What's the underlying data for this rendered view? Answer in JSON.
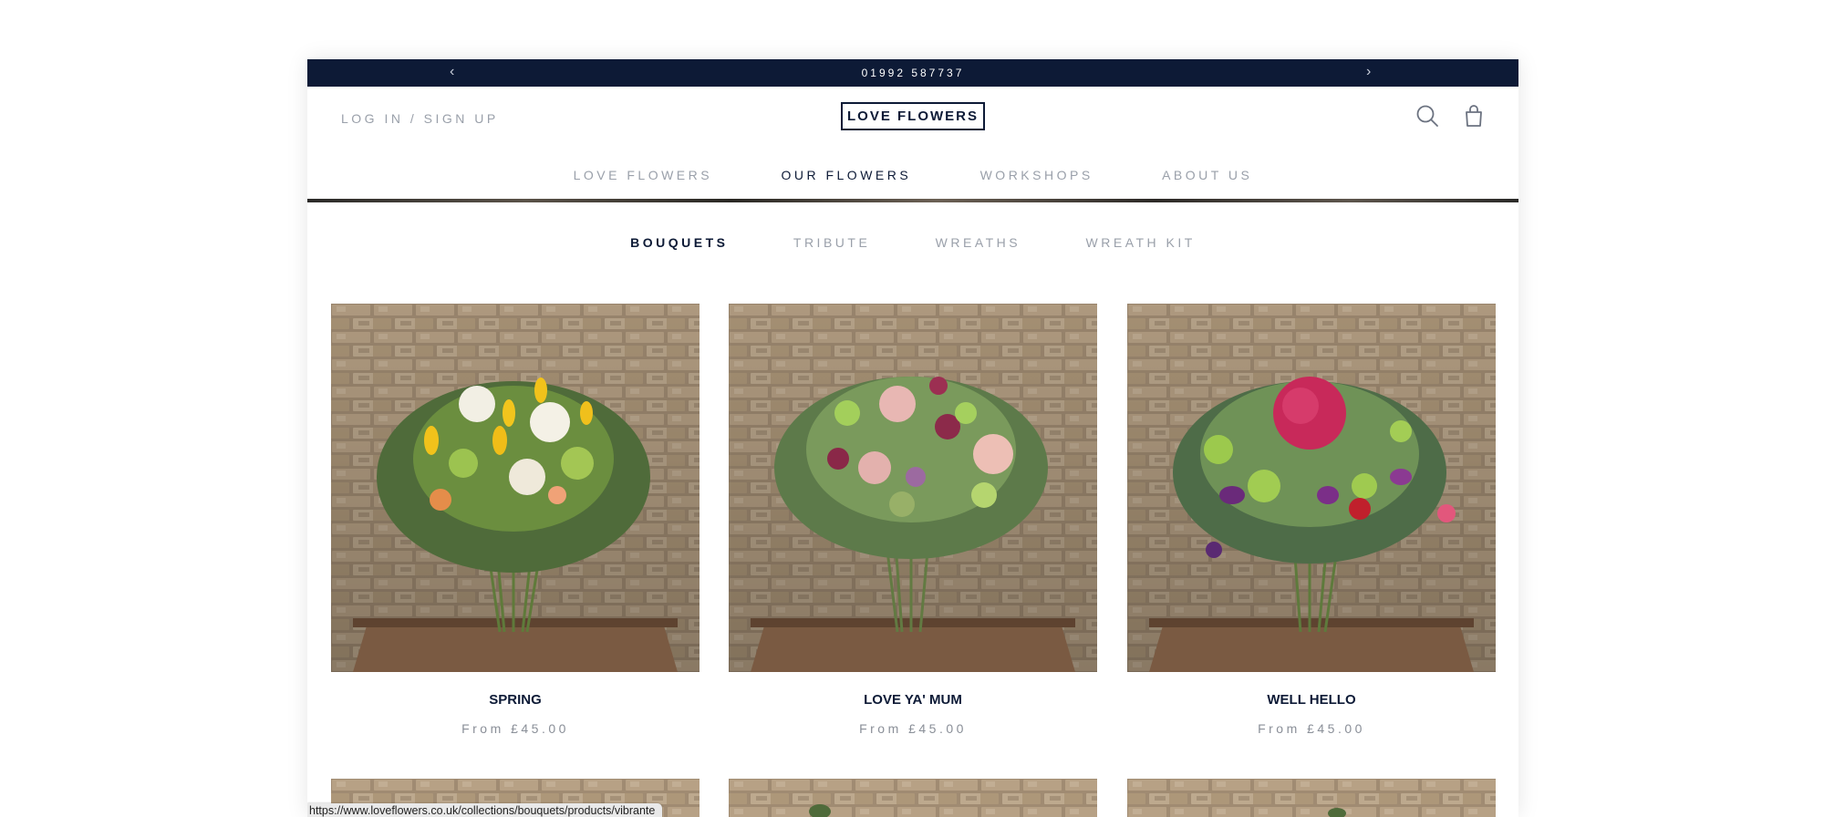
{
  "announcement": {
    "text": "01992 587737",
    "prev_icon": "chevron-left-icon",
    "next_icon": "chevron-right-icon"
  },
  "header": {
    "login_label": "LOG IN / SIGN UP",
    "logo_text": "LOVE FLOWERS",
    "search_icon": "search-icon",
    "cart_icon": "shopping-bag-icon"
  },
  "nav": {
    "items": [
      {
        "label": "LOVE FLOWERS",
        "active": false
      },
      {
        "label": "OUR FLOWERS",
        "active": true
      },
      {
        "label": "WORKSHOPS",
        "active": false
      },
      {
        "label": "ABOUT US",
        "active": false
      }
    ]
  },
  "collections": {
    "items": [
      {
        "label": "BOUQUETS",
        "active": true
      },
      {
        "label": "TRIBUTE",
        "active": false
      },
      {
        "label": "WREATHS",
        "active": false
      },
      {
        "label": "WREATH KIT",
        "active": false
      }
    ]
  },
  "products": [
    {
      "name": "SPRING",
      "price": "From £45.00"
    },
    {
      "name": "LOVE YA' MUM",
      "price": "From £45.00"
    },
    {
      "name": "WELL HELLO",
      "price": "From £45.00"
    }
  ],
  "status_bar": {
    "url": "https://www.loveflowers.co.uk/collections/bouquets/products/vibrante"
  },
  "colors": {
    "navy": "#0d1a36",
    "muted": "#9aa0aa",
    "status_bg": "#e9e9e9"
  }
}
